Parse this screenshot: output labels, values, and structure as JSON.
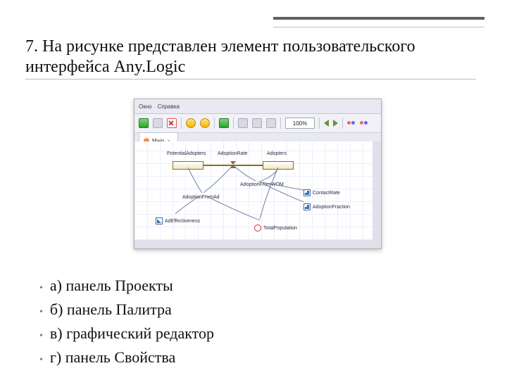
{
  "question": "7. На рисунке представлен элемент пользовательского интерфейса Any.Logic",
  "answers": [
    "а) панель Проекты",
    "б) панель Палитра",
    "в) графический редактор",
    "г) панель Свойства"
  ],
  "screenshot": {
    "menubar": [
      "Окно",
      "Справка"
    ],
    "toolbar": {
      "zoom": "100%"
    },
    "tab": {
      "label": "Main"
    },
    "diagram": {
      "stocks": [
        "PotentialAdopters",
        "Adopters"
      ],
      "flow": "AdoptionRate",
      "vars": [
        "AdoptionFromAd",
        "AdoptionFromWOM"
      ],
      "params": [
        "AdEffectiveness",
        "ContactRate",
        "AdoptionFraction"
      ],
      "dynamic": "TotalPopulation"
    }
  }
}
